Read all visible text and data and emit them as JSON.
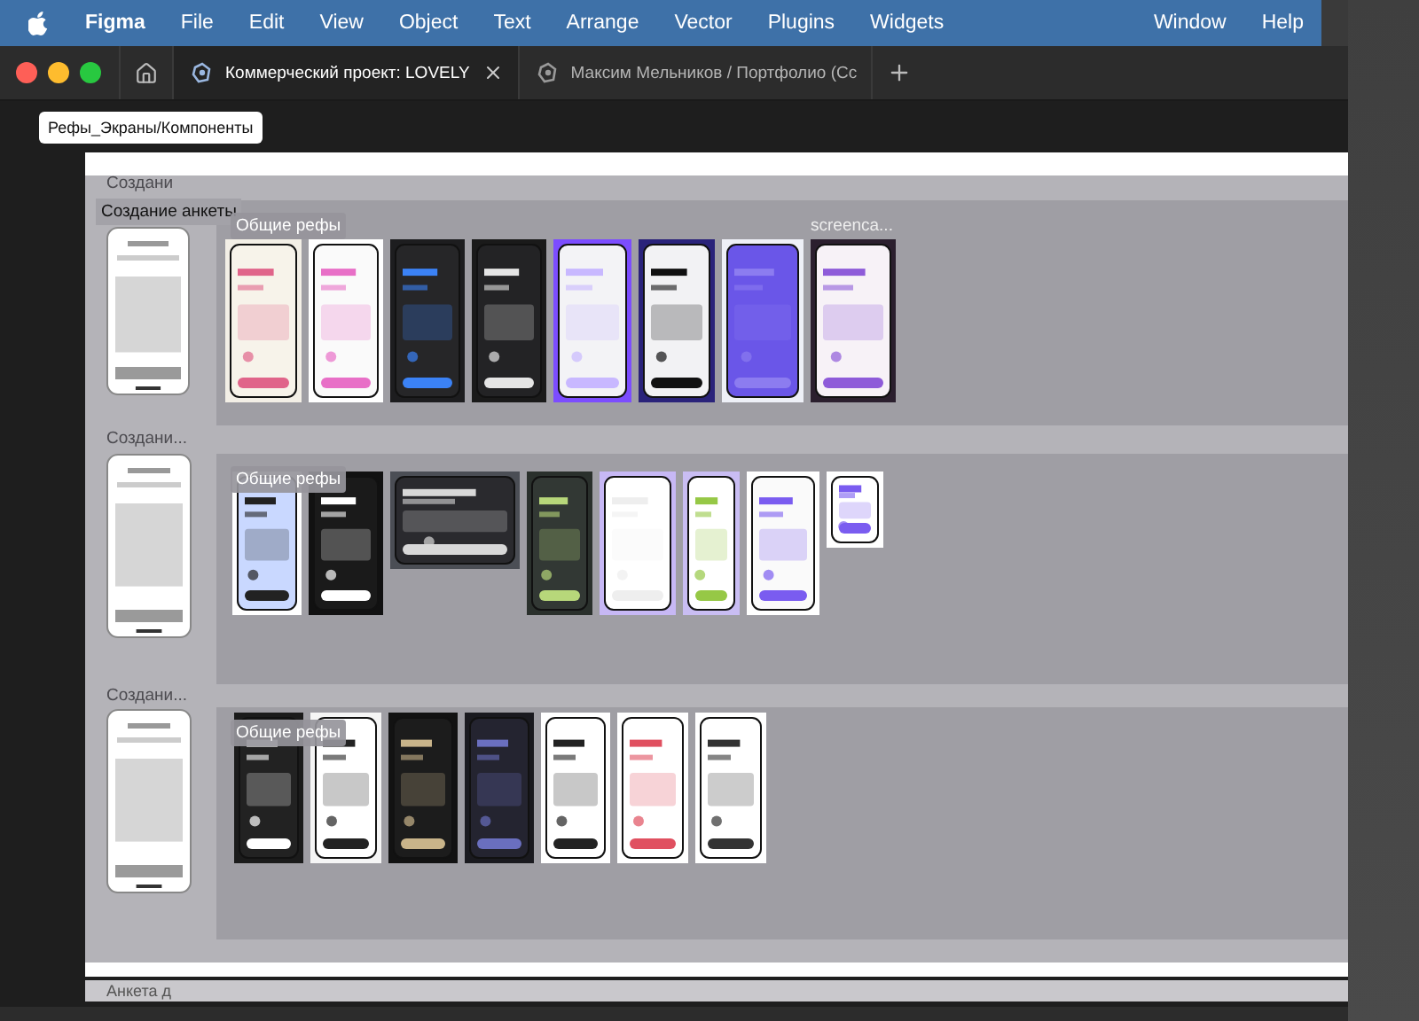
{
  "menu_bar": {
    "app": "Figma",
    "items": [
      "File",
      "Edit",
      "View",
      "Object",
      "Text",
      "Arrange",
      "Vector",
      "Plugins",
      "Widgets"
    ],
    "right_items": [
      "Window",
      "Help"
    ]
  },
  "tabs": [
    {
      "title": "Коммерческий проект: LOVELY",
      "selected": true
    },
    {
      "title": "Максим Мельников / Портфолио (Сс",
      "selected": false
    }
  ],
  "canvas": {
    "frame_label": "Рефы_Экраны/Компоненты",
    "sections": [
      {
        "title": "Создани",
        "tag": "Создание анкеты",
        "template": {
          "kind": "picture"
        },
        "refs_label": "Общие рефы",
        "refs": [
          {
            "kind": "picture"
          },
          {
            "kind": "picture"
          },
          {
            "kind": "picture"
          },
          {
            "kind": "picture"
          },
          {
            "kind": "picture"
          },
          {
            "kind": "picture"
          },
          {
            "kind": "picture"
          },
          {
            "kind": "picture",
            "caption": "screenca..."
          }
        ]
      },
      {
        "title": "Создани...",
        "template": {
          "kind": "picture"
        },
        "refs_label": "Общие рефы",
        "refs": [
          {
            "kind": "picture"
          },
          {
            "kind": "picture"
          },
          {
            "kind": "picture"
          },
          {
            "kind": "picture"
          },
          {
            "kind": "picture"
          },
          {
            "kind": "picture"
          },
          {
            "kind": "picture"
          },
          {
            "kind": "picture"
          }
        ]
      },
      {
        "title": "Создани...",
        "template": {
          "kind": "picture"
        },
        "refs_label": "Общие рефы",
        "refs": [
          {
            "kind": "picture"
          },
          {
            "kind": "picture"
          },
          {
            "kind": "picture"
          },
          {
            "kind": "picture"
          },
          {
            "kind": "picture"
          },
          {
            "kind": "picture"
          },
          {
            "kind": "picture"
          }
        ]
      }
    ],
    "next_section_title": "Анкета д"
  }
}
